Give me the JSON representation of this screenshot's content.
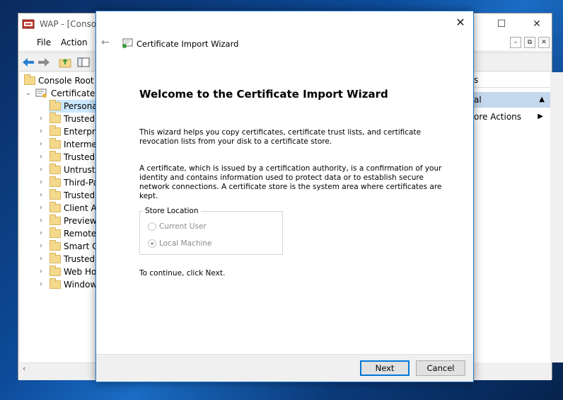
{
  "mmc": {
    "title": "WAP - [Console",
    "menu": [
      "File",
      "Action"
    ],
    "tree": {
      "root": "Console Root",
      "certificates": "Certificates (",
      "items": [
        "Personal",
        "Trusted R",
        "Enterpris",
        "Intermed",
        "Trusted P",
        "Untruste",
        "Third-Pa",
        "Trusted P",
        "Client Au",
        "Preview",
        "Remote",
        "Smart Ca",
        "Trusted D",
        "Web Hos",
        "Window"
      ]
    },
    "actions": {
      "header": "s",
      "section": "al",
      "more_actions": "ore Actions"
    }
  },
  "wizard": {
    "header_title": "Certificate Import Wizard",
    "heading": "Welcome to the Certificate Import Wizard",
    "para1": "This wizard helps you copy certificates, certificate trust lists, and certificate revocation lists from your disk to a certificate store.",
    "para2": "A certificate, which is issued by a certification authority, is a confirmation of your identity and contains information used to protect data or to establish secure network connections. A certificate store is the system area where certificates are kept.",
    "store_location": {
      "label": "Store Location",
      "options": [
        {
          "label": "Current User",
          "selected": false
        },
        {
          "label": "Local Machine",
          "selected": true
        }
      ]
    },
    "continue_text": "To continue, click Next.",
    "buttons": {
      "next": "Next",
      "cancel": "Cancel"
    }
  }
}
